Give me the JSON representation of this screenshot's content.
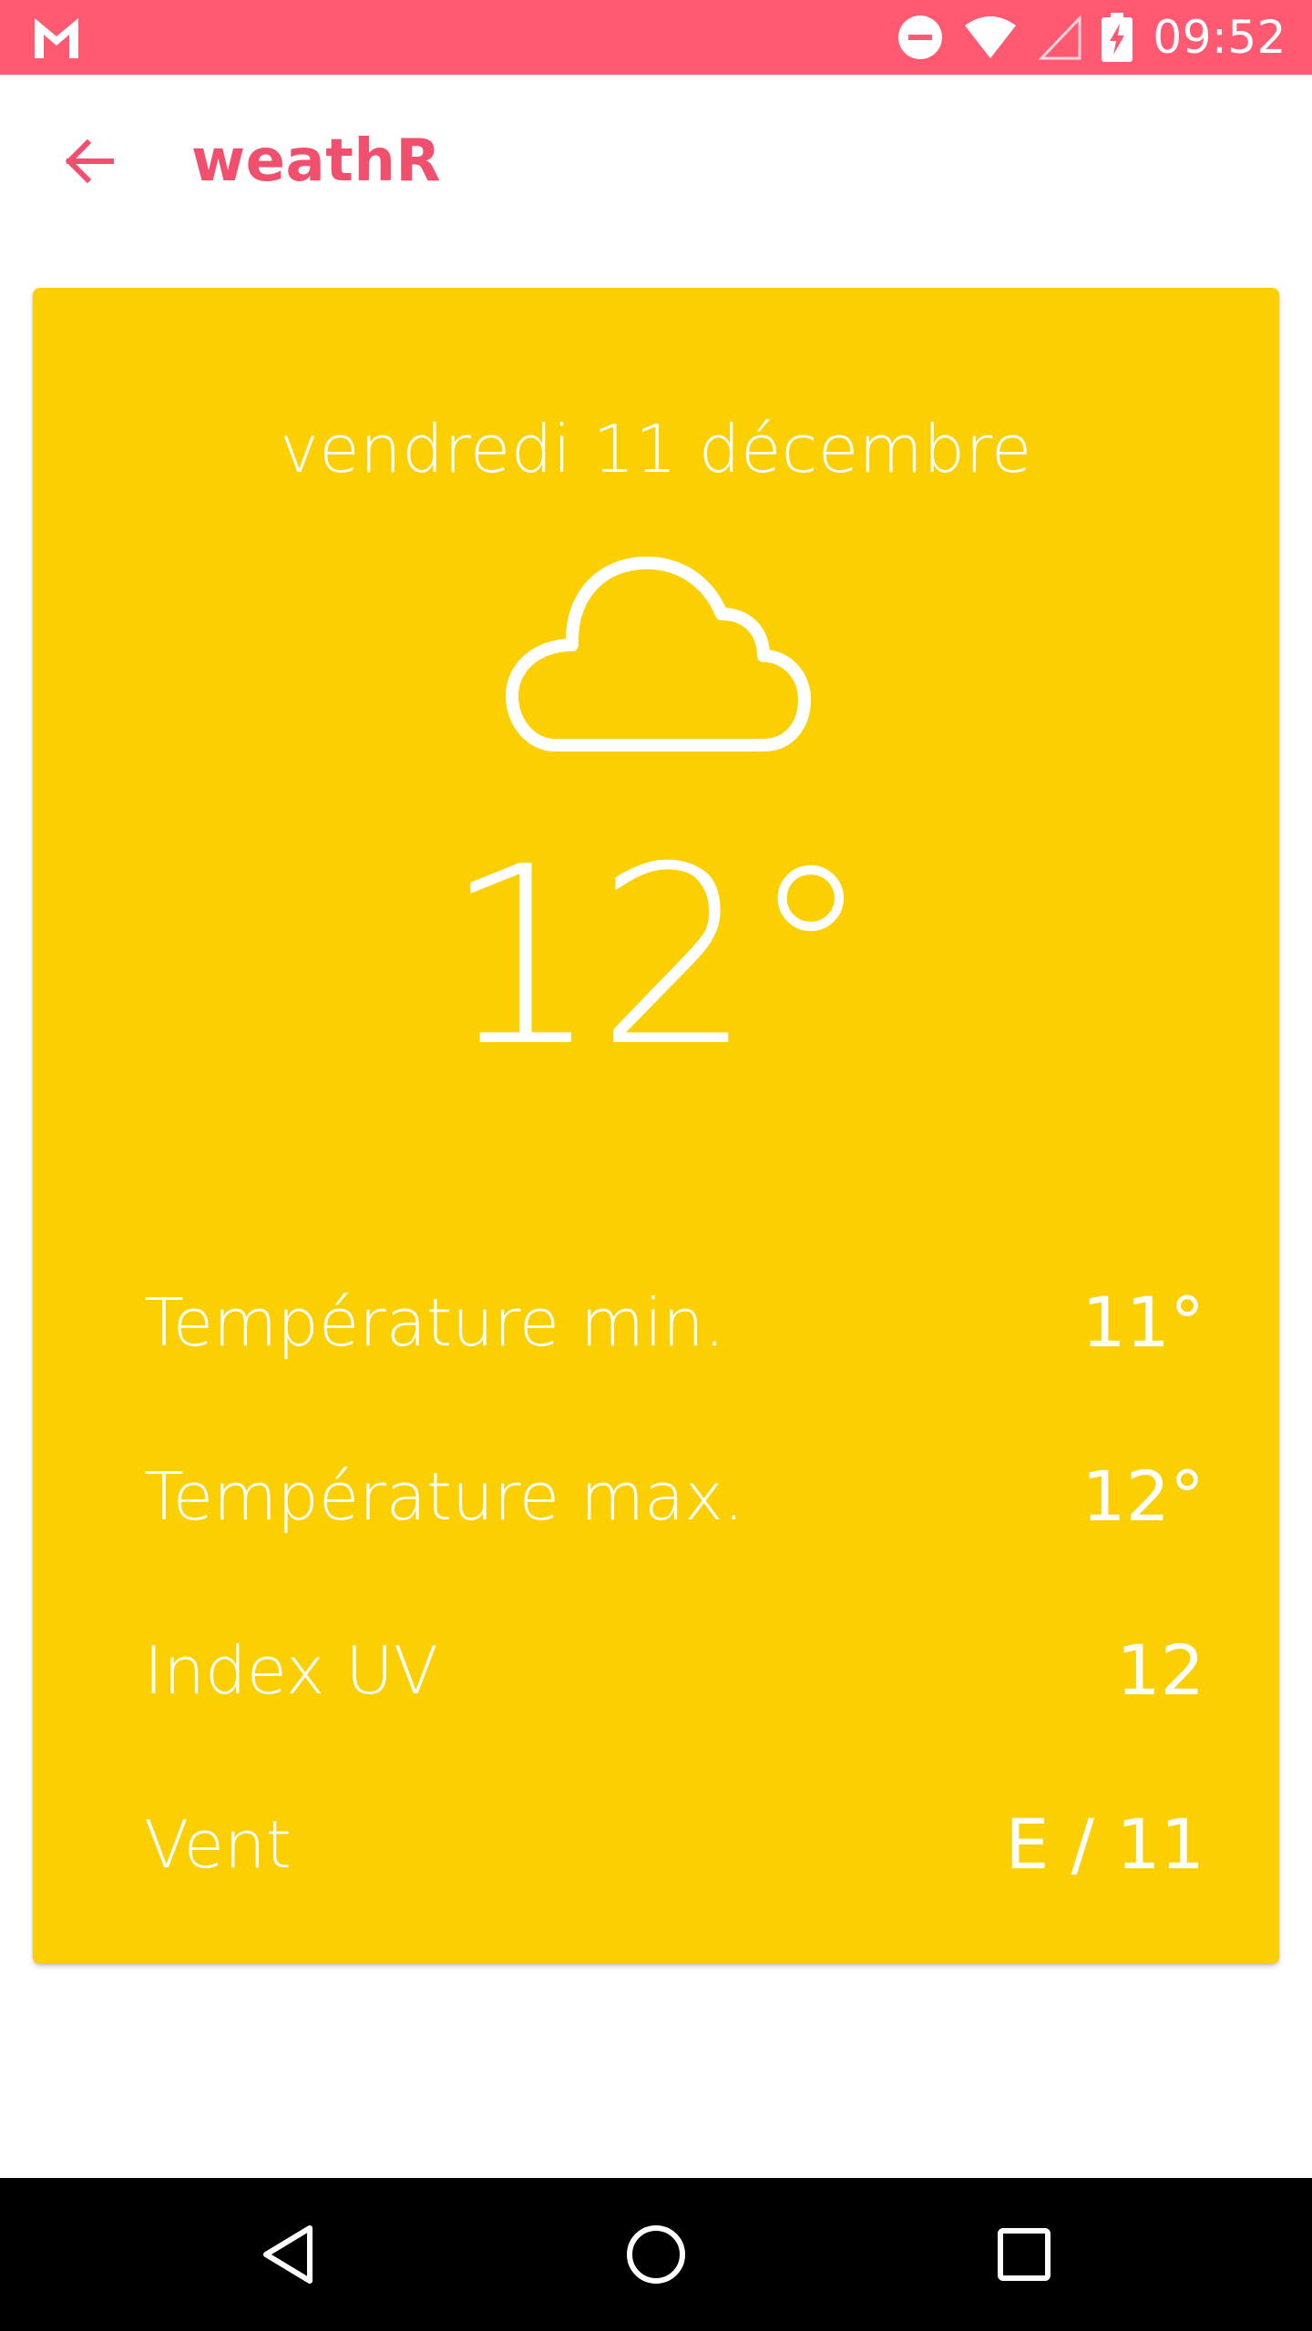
{
  "status_bar": {
    "time": "09:52",
    "icons": [
      "gmail-icon",
      "do-not-disturb-icon",
      "wifi-icon",
      "cell-signal-icon",
      "battery-charging-icon"
    ],
    "background": "#ff5a72"
  },
  "app_bar": {
    "title": "weathR",
    "back_icon": "arrow-back-icon",
    "accent": "#f0506e"
  },
  "weather": {
    "date": "vendredi 11 décembre",
    "condition_icon": "cloud-icon",
    "temperature": "12°",
    "card_color": "#fccf03",
    "details": [
      {
        "label": "Température min.",
        "value": "11°"
      },
      {
        "label": "Température max.",
        "value": "12°"
      },
      {
        "label": "Index UV",
        "value": "12"
      },
      {
        "label": "Vent",
        "value": "E / 11"
      }
    ]
  },
  "nav_bar": {
    "buttons": [
      "nav-back-icon",
      "nav-home-icon",
      "nav-recents-icon"
    ]
  }
}
